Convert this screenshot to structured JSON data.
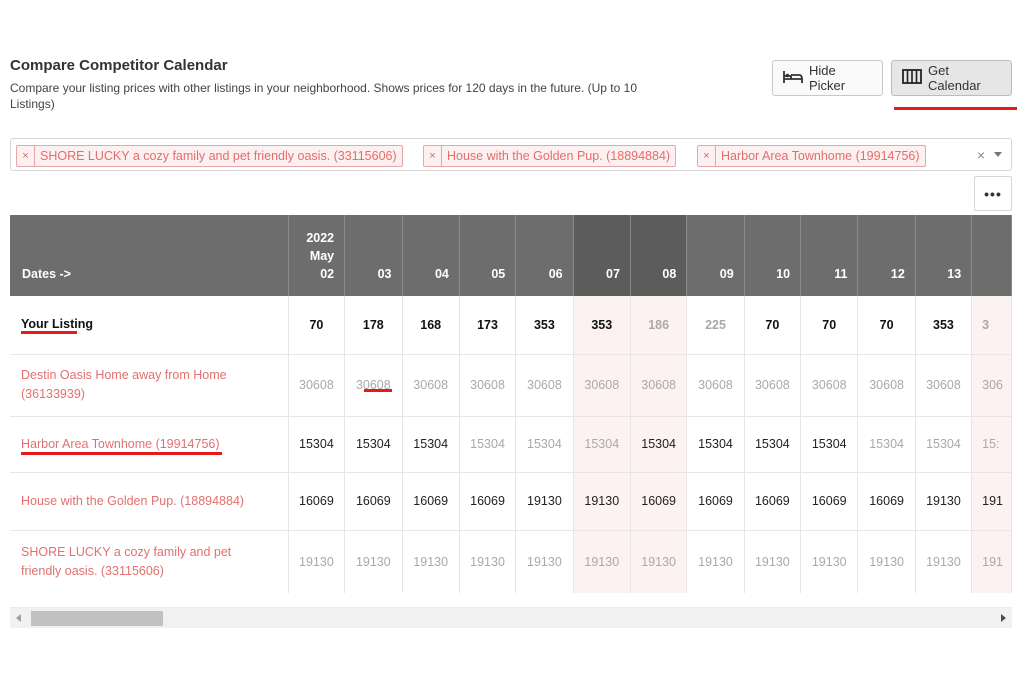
{
  "header": {
    "title": "Compare Competitor Calendar",
    "subtitle": "Compare your listing prices with other listings in your neighborhood. Shows prices for 120 days in the future. (Up to 10 Listings)"
  },
  "buttons": {
    "hide_picker": "Hide Picker",
    "get_calendar": "Get Calendar",
    "more": "•••"
  },
  "picker": {
    "tags": [
      "SHORE LUCKY a cozy family and pet friendly oasis. (33115606)",
      "House with the Golden Pup. (18894884)",
      "Harbor Area Townhome (19914756)"
    ],
    "remove_glyph": "×",
    "clear_glyph": "×"
  },
  "table": {
    "dates_header": "Dates ->",
    "year": "2022",
    "month": "May",
    "days": [
      "02",
      "03",
      "04",
      "05",
      "06",
      "07",
      "08",
      "09",
      "10",
      "11",
      "12",
      "13"
    ],
    "dark_columns": [
      5,
      6
    ],
    "rows": [
      {
        "label": "Your Listing",
        "values": [
          "70",
          "178",
          "168",
          "173",
          "353",
          "353",
          "186",
          "225",
          "70",
          "70",
          "70",
          "353",
          "3"
        ],
        "muted": [
          6,
          7,
          12
        ]
      },
      {
        "label": "Destin Oasis Home away from Home (36133939)",
        "values": [
          "30608",
          "30608",
          "30608",
          "30608",
          "30608",
          "30608",
          "30608",
          "30608",
          "30608",
          "30608",
          "30608",
          "30608",
          "306"
        ],
        "muted": [
          0,
          1,
          2,
          3,
          4,
          5,
          6,
          7,
          8,
          9,
          10,
          11,
          12
        ]
      },
      {
        "label": "Harbor Area Townhome (19914756)",
        "values": [
          "15304",
          "15304",
          "15304",
          "15304",
          "15304",
          "15304",
          "15304",
          "15304",
          "15304",
          "15304",
          "15304",
          "15304",
          "15:"
        ],
        "muted": [
          3,
          4,
          5,
          10,
          11,
          12
        ]
      },
      {
        "label": "House with the Golden Pup. (18894884)",
        "values": [
          "16069",
          "16069",
          "16069",
          "16069",
          "19130",
          "19130",
          "16069",
          "16069",
          "16069",
          "16069",
          "16069",
          "19130",
          "191"
        ],
        "muted": []
      },
      {
        "label": "SHORE LUCKY a cozy family and pet friendly oasis. (33115606)",
        "values": [
          "19130",
          "19130",
          "19130",
          "19130",
          "19130",
          "19130",
          "19130",
          "19130",
          "19130",
          "19130",
          "19130",
          "19130",
          "191"
        ],
        "muted": [
          0,
          1,
          2,
          3,
          4,
          5,
          6,
          7,
          8,
          9,
          10,
          11,
          12
        ]
      }
    ]
  },
  "colors": {
    "accent_red": "#e41b1b",
    "tag_text": "#e56d6d",
    "header_bg": "#6d6d6d",
    "header_dark_bg": "#5c5c5c"
  },
  "icons": {
    "hide_picker": "bed-icon",
    "get_calendar": "columns-icon",
    "more": "ellipsis-icon"
  }
}
